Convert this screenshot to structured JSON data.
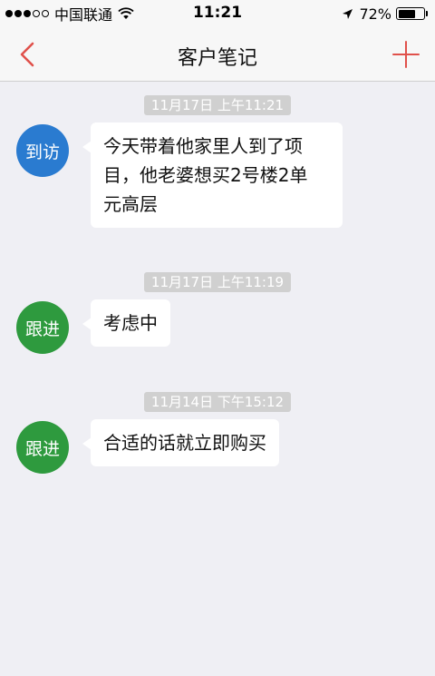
{
  "status_bar": {
    "carrier": "中国联通",
    "time": "11:21",
    "battery_percent": "72%",
    "battery_level": 0.72,
    "signal_icon": "signal-dots-icon",
    "wifi_icon": "wifi-icon",
    "location_icon": "location-arrow-icon",
    "battery_icon": "battery-icon"
  },
  "nav": {
    "title": "客户笔记",
    "back_icon": "chevron-left-icon",
    "add_icon": "plus-icon",
    "accent_color": "#e0514b"
  },
  "notes": [
    {
      "timestamp": "11月17日 上午11:21",
      "tag": "到访",
      "tag_color": "#2a7bd0",
      "text_lines": [
        "今天带着他家里人到了项",
        "目，他老婆想买2号楼2单",
        "元高层"
      ]
    },
    {
      "timestamp": "11月17日 上午11:19",
      "tag": "跟进",
      "tag_color": "#2e9a3e",
      "text_lines": [
        "考虑中"
      ]
    },
    {
      "timestamp": "11月14日 下午15:12",
      "tag": "跟进",
      "tag_color": "#2e9a3e",
      "text_lines": [
        "合适的话就立即购买"
      ]
    }
  ]
}
